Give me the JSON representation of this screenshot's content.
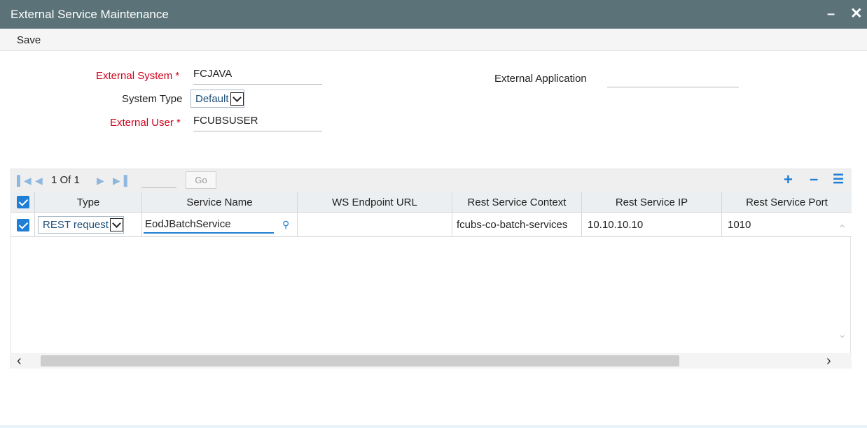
{
  "window": {
    "title": "External Service Maintenance",
    "minimize_icon": "minus",
    "close_icon": "close-x"
  },
  "toolbar": {
    "save_label": "Save"
  },
  "form": {
    "external_system": {
      "label": "External System",
      "required_mark": "*",
      "value": "FCJAVA"
    },
    "system_type": {
      "label": "System Type",
      "value": "Default"
    },
    "external_user": {
      "label": "External User",
      "required_mark": "*",
      "value": "FCUBSUSER"
    },
    "external_application": {
      "label": "External Application",
      "value": ""
    }
  },
  "grid": {
    "pager": {
      "text": "1 Of 1",
      "go_label": "Go",
      "page_input": ""
    },
    "toolbar_icons": [
      "add-row-icon",
      "delete-row-icon",
      "single-view-icon"
    ],
    "columns": [
      "Type",
      "Service Name",
      "WS Endpoint URL",
      "Rest Service Context",
      "Rest Service IP",
      "Rest Service Port"
    ],
    "rows": [
      {
        "selected": true,
        "type": "REST request",
        "service_name": "EodJBatchService",
        "ws_endpoint_url": "",
        "rest_service_context": "fcubs-co-batch-services",
        "rest_service_ip": "10.10.10.10",
        "rest_service_port": "1010"
      }
    ]
  }
}
